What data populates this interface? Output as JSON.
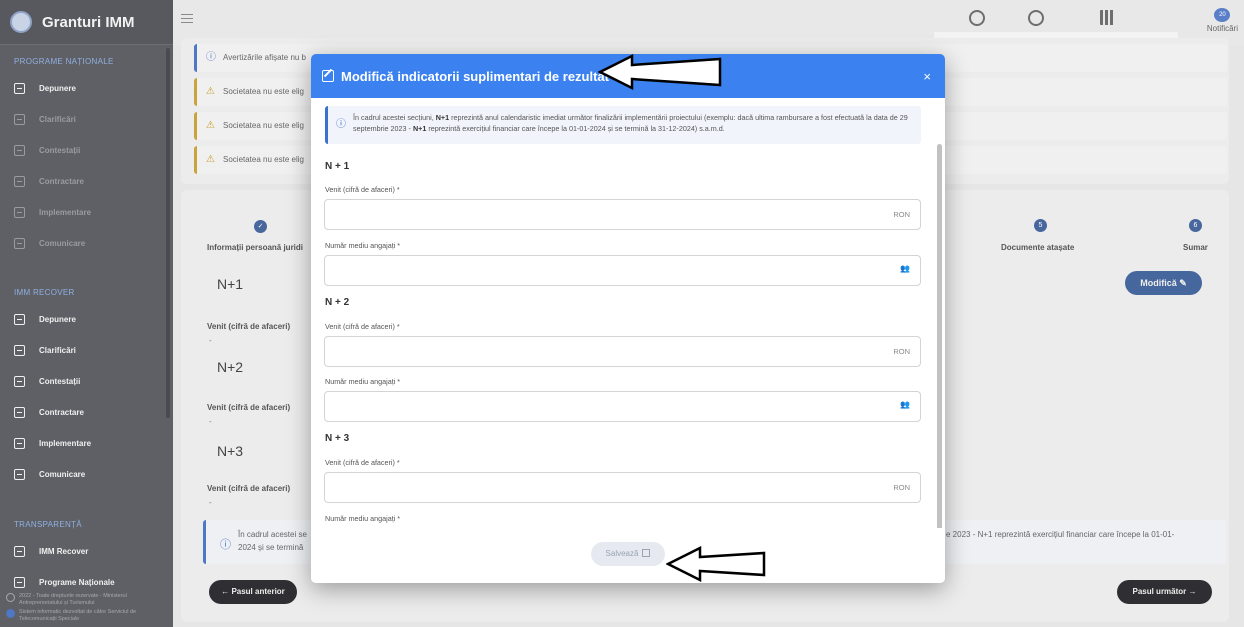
{
  "sidebar": {
    "brand": "Granturi IMM",
    "sections": [
      {
        "title": "PROGRAME NAȚIONALE",
        "items": [
          {
            "label": "Depunere",
            "enabled": true
          },
          {
            "label": "Clarificări",
            "enabled": false
          },
          {
            "label": "Contestații",
            "enabled": false
          },
          {
            "label": "Contractare",
            "enabled": false
          },
          {
            "label": "Implementare",
            "enabled": false
          },
          {
            "label": "Comunicare",
            "enabled": false
          }
        ]
      },
      {
        "title": "IMM RECOVER",
        "items": [
          {
            "label": "Depunere",
            "enabled": true
          },
          {
            "label": "Clarificări",
            "enabled": true
          },
          {
            "label": "Contestații",
            "enabled": true
          },
          {
            "label": "Contractare",
            "enabled": true
          },
          {
            "label": "Implementare",
            "enabled": true
          },
          {
            "label": "Comunicare",
            "enabled": true
          }
        ]
      },
      {
        "title": "TRANSPARENȚĂ",
        "items": [
          {
            "label": "IMM Recover",
            "enabled": true
          },
          {
            "label": "Programe Naționale",
            "enabled": true
          }
        ]
      }
    ],
    "footer_line1": "2022 - Toate drepturile rezervate - Ministerul Antreprenoriatului și Turismului",
    "footer_line2": "Sistem informatic dezvoltat de către Serviciul de Telecomunicații Speciale"
  },
  "topbar": {
    "notifications_label": "Notificări",
    "notifications_count": "20",
    "icons": [
      "clock-icon",
      "user-circle-icon",
      "building-icon"
    ]
  },
  "background": {
    "alerts": [
      {
        "text": "Avertizările afișate nu b",
        "kind": "info"
      },
      {
        "text": "Societatea nu este elig",
        "kind": "warning"
      },
      {
        "text": "Societatea nu este elig",
        "kind": "warning"
      },
      {
        "text": "Societatea nu este elig",
        "kind": "warning"
      }
    ],
    "steps": [
      {
        "label": "Informații persoană juridi",
        "num": "✓"
      },
      {
        "label": "Documente atașate",
        "num": "5"
      },
      {
        "label": "Sumar",
        "num": "6"
      }
    ],
    "groups": [
      {
        "title": "N+1",
        "field": "Venit (cifră de afaceri)",
        "value": "-"
      },
      {
        "title": "N+2",
        "field": "Venit (cifră de afaceri)",
        "value": "-"
      },
      {
        "title": "N+3",
        "field": "Venit (cifră de afaceri)",
        "value": "-"
      }
    ],
    "modify_button": "Modifică",
    "info_left_1": "În cadrul acestei se",
    "info_left_2": "2024 și se termină",
    "info_right": "e 2023 - N+1 reprezintă exercițiul financiar care începe la 01-01-",
    "prev_button": "Pasul anterior",
    "next_button": "Pasul următor"
  },
  "modal": {
    "title": "Modifică indicatorii suplimentari de rezultat",
    "close": "×",
    "info_part1": "În cadrul acestei secțiuni, ",
    "info_bold1": "N+1",
    "info_part2": " reprezintă anul calendaristic imediat următor finalizării implementării proiectului (exemplu: dacă ultima rambursare a fost efectuată la data de 29 septembrie 2023 - ",
    "info_bold2": "N+1",
    "info_part3": " reprezintă exercițiul financiar care începe la 01-01-2024 și se termină la 31-12-2024) s.a.m.d.",
    "sections": [
      {
        "heading": "N + 1",
        "revenue_label": "Venit (cifră de afaceri) *",
        "revenue_value": "",
        "revenue_suffix": "RON",
        "employees_label": "Număr mediu angajați *",
        "employees_value": ""
      },
      {
        "heading": "N + 2",
        "revenue_label": "Venit (cifră de afaceri) *",
        "revenue_value": "",
        "revenue_suffix": "RON",
        "employees_label": "Număr mediu angajați *",
        "employees_value": ""
      },
      {
        "heading": "N + 3",
        "revenue_label": "Venit (cifră de afaceri) *",
        "revenue_value": "",
        "revenue_suffix": "RON",
        "employees_label": "Număr mediu angajați *",
        "employees_value": ""
      }
    ],
    "save_button": "Salvează"
  }
}
